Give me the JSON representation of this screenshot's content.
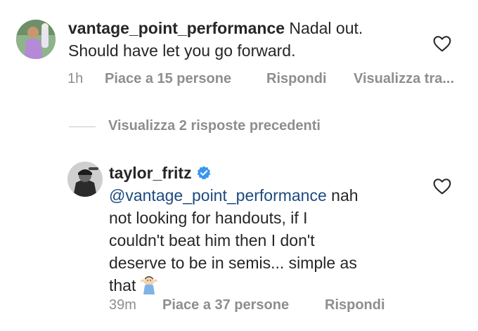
{
  "comments": [
    {
      "username": "vantage_point_performance",
      "text_line1": "Nadal out.",
      "text_line2": "Should have let you go forward.",
      "time": "1h",
      "likes": "Piace a 15 persone",
      "reply": "Rispondi",
      "translate": "Visualizza tra..."
    },
    {
      "username": "taylor_fritz",
      "mention": "@vantage_point_performance",
      "text_after_mention": "nah",
      "text_line2": "not looking for handouts, if I",
      "text_line3": "couldn't beat him then I don't",
      "text_line4": "deserve to be in semis... simple as",
      "text_line5": "that",
      "time": "39m",
      "likes": "Piace a 37 persone",
      "reply": "Rispondi"
    }
  ],
  "view_replies": "Visualizza 2 risposte precedenti",
  "icons": {
    "heart": "heart-icon",
    "verified": "verified-badge-icon",
    "emoji": "person-shrugging-emoji"
  },
  "colors": {
    "text": "#262626",
    "secondary": "#8e8e8e",
    "mention": "#1d4a7f",
    "verified": "#3897f0"
  }
}
